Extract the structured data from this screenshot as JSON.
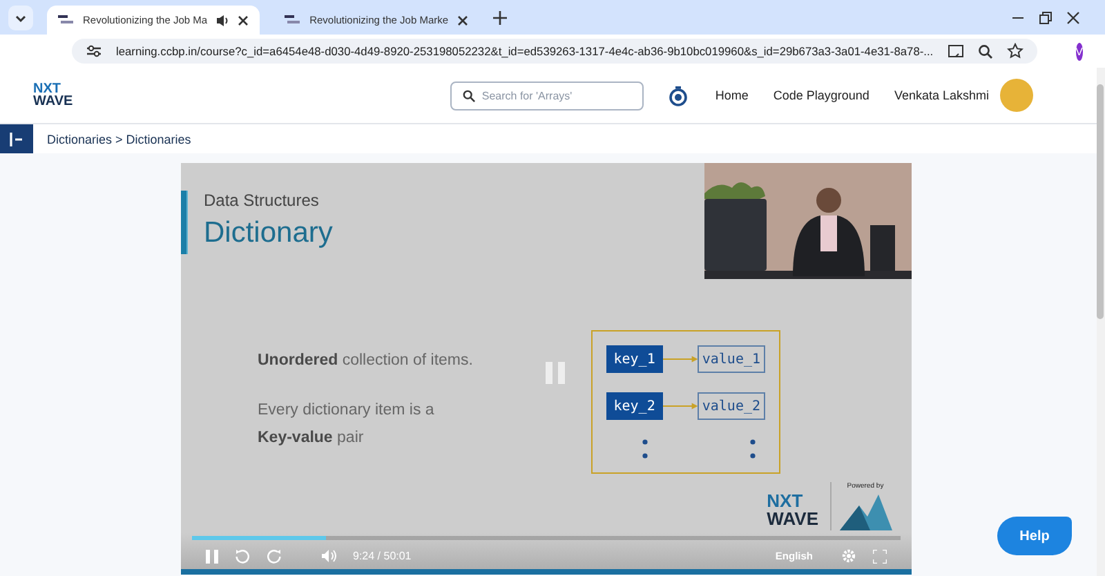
{
  "browser": {
    "tabs": [
      {
        "title": "Revolutionizing the Job Ma",
        "selected": true,
        "audio": true
      },
      {
        "title": "Revolutionizing the Job Marke",
        "selected": false,
        "audio": false
      }
    ],
    "url": "learning.ccbp.in/course?c_id=a6454e48-d030-4d49-8920-253198052232&t_id=ed539263-1317-4e4c-ab36-9b10bc019960&s_id=29b673a3-3a01-4e31-8a78-...",
    "profile_initial": "V"
  },
  "header": {
    "logo_top": "NXT",
    "logo_bottom": "WAVE",
    "search": {
      "placeholder": "Search for 'Arrays'"
    },
    "nav": [
      "Home",
      "Code Playground"
    ],
    "user": "Venkata Lakshmi"
  },
  "breadcrumb": "Dictionaries > Dictionaries",
  "slide": {
    "subtitle": "Data Structures",
    "title": "Dictionary",
    "points": [
      "**Unordered** collection of items.",
      "Every dictionary item is a\n**Key-value** pair"
    ],
    "pairs": [
      {
        "key": "key_1",
        "value": "value_1"
      },
      {
        "key": "key_2",
        "value": "value_2"
      }
    ],
    "brand_top": "NXT",
    "brand_bottom": "WAVE",
    "powered_by": "Powered by"
  },
  "player": {
    "playing": true,
    "level": 0.19,
    "time": "9:24 / 50:01",
    "language": "English"
  },
  "help": "Help"
}
